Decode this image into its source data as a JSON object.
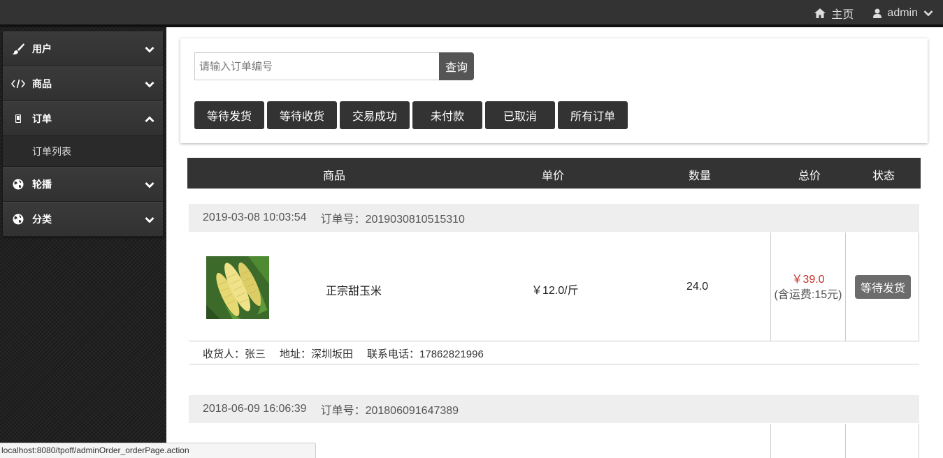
{
  "topnav": {
    "home_label": "主页",
    "user_label": "admin"
  },
  "sidebar": {
    "items": [
      {
        "label": "用户",
        "icon": "brush-icon"
      },
      {
        "label": "商品",
        "icon": "code-icon"
      },
      {
        "label": "订单",
        "icon": "mobile-icon",
        "expanded": true,
        "children": [
          "订单列表"
        ]
      },
      {
        "label": "轮播",
        "icon": "globe-icon"
      },
      {
        "label": "分类",
        "icon": "globe-icon"
      }
    ]
  },
  "search": {
    "placeholder": "请输入订单编号",
    "button_label": "查询"
  },
  "filters": [
    "等待发货",
    "等待收货",
    "交易成功",
    "未付款",
    "已取消",
    "所有订单"
  ],
  "table": {
    "headers": [
      "商品",
      "单价",
      "数量",
      "总价",
      "状态"
    ]
  },
  "orders": [
    {
      "datetime": "2019-03-08 10:03:54",
      "order_no": "订单号：2019030810515310",
      "product": "正宗甜玉米",
      "unit_price": "￥12.0/斤",
      "quantity": "24.0",
      "total": "￥39.0",
      "shipping": "(含运费:15元)",
      "status": "等待发货",
      "receiver": "收货人：张三",
      "address": "地址：深圳坂田",
      "phone": "联系电话：17862821996"
    },
    {
      "datetime": "2018-06-09 16:06:39",
      "order_no": "订单号：201806091647389"
    }
  ],
  "statusbar": {
    "url": "localhost:8080/tpoff/adminOrder_orderPage.action"
  },
  "colors": {
    "topbar": "#333333",
    "price_red": "#c9302c",
    "button_dark": "#333333",
    "status_button": "#6c6c6c"
  }
}
